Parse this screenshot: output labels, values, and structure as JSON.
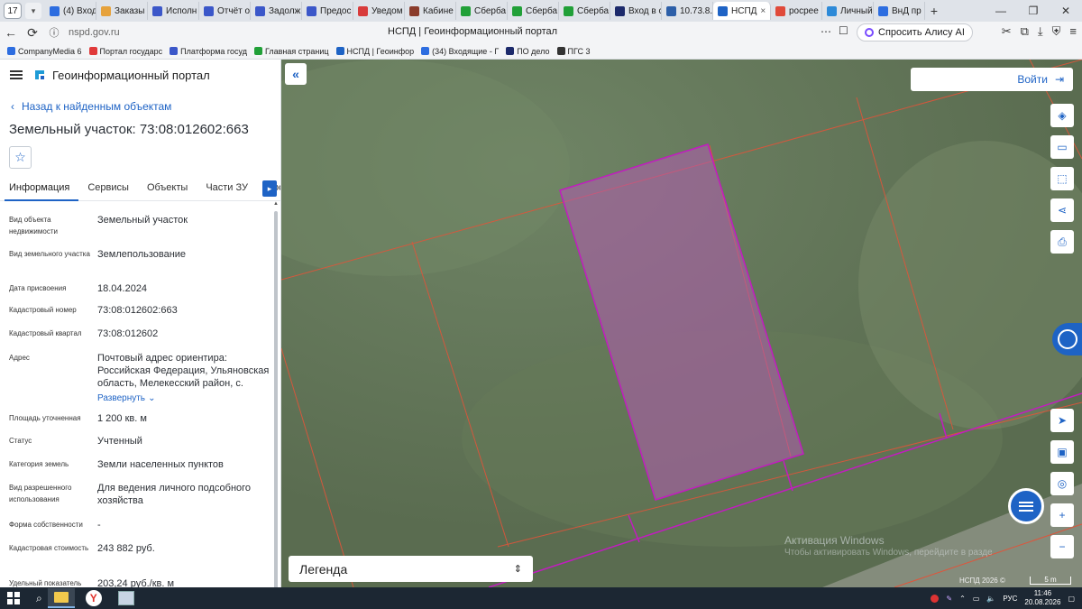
{
  "browser": {
    "tab_count": "17",
    "tabs": [
      {
        "label": "(4) Вход",
        "color": "#2d6de0"
      },
      {
        "label": "Заказы",
        "color": "#e6a23c"
      },
      {
        "label": "Исполн",
        "color": "#3b57c9"
      },
      {
        "label": "Отчёт о",
        "color": "#3b57c9"
      },
      {
        "label": "Задолж",
        "color": "#3b57c9"
      },
      {
        "label": "Предос",
        "color": "#3b57c9"
      },
      {
        "label": "Уведом",
        "color": "#d83b3b"
      },
      {
        "label": "Кабине",
        "color": "#8a3b2b"
      },
      {
        "label": "Сберба",
        "color": "#21a038"
      },
      {
        "label": "Сберба",
        "color": "#21a038"
      },
      {
        "label": "Сберба",
        "color": "#21a038"
      },
      {
        "label": "Вход в с",
        "color": "#1d2a6b"
      },
      {
        "label": "10.73.8.",
        "color": "#2d5fa8"
      },
      {
        "label": "НСПД",
        "color": "#1e63c5",
        "active": true
      },
      {
        "label": "росрее",
        "color": "#e04a3a"
      },
      {
        "label": "Личный",
        "color": "#2d8ad8"
      },
      {
        "label": "ВнД пр",
        "color": "#2d6de0"
      }
    ],
    "url": "nspd.gov.ru",
    "page_title": "НСПД | Геоинформационный портал",
    "alisa_label": "Спросить Алису AI",
    "bookmarks": [
      {
        "label": "CompanyMedia 6",
        "color": "#2d6de0"
      },
      {
        "label": "Портал государс",
        "color": "#e03a3a"
      },
      {
        "label": "Платформа госуд",
        "color": "#3b57c9"
      },
      {
        "label": "Главная страниц",
        "color": "#21a038"
      },
      {
        "label": "НСПД | Геоинфор",
        "color": "#1e63c5"
      },
      {
        "label": "(34) Входящие - Г",
        "color": "#2d6de0"
      },
      {
        "label": "ПО дело",
        "color": "#1d2a6b"
      },
      {
        "label": "ПГС 3",
        "color": "#333333"
      }
    ]
  },
  "portal": {
    "title": "Геоинформационный портал",
    "back_label": "Назад к найденным объектам",
    "object_title": "Земельный участок: 73:08:012602:663",
    "tabs": [
      "Информация",
      "Сервисы",
      "Объекты",
      "Части ЗУ",
      "Состав"
    ],
    "properties": [
      {
        "key": "Вид объекта недвижимости",
        "value": "Земельный участок"
      },
      {
        "key": "Вид земельного участка",
        "value": "Землепользование"
      },
      {
        "key": "Дата присвоения",
        "value": "18.04.2024"
      },
      {
        "key": "Кадастровый номер",
        "value": "73:08:012602:663"
      },
      {
        "key": "Кадастровый квартал",
        "value": "73:08:012602"
      },
      {
        "key": "Адрес",
        "value": "Почтовый адрес ориентира: Российская Федерация, Ульяновская область, Мелекесский район, с."
      },
      {
        "key": "Площадь уточненная",
        "value": "1 200 кв. м"
      },
      {
        "key": "Статус",
        "value": "Учтенный"
      },
      {
        "key": "Категория земель",
        "value": "Земли населенных пунктов"
      },
      {
        "key": "Вид разрешенного использования",
        "value": "Для ведения личного подсобного хозяйства"
      },
      {
        "key": "Форма собственности",
        "value": "-"
      },
      {
        "key": "Кадастровая стоимость",
        "value": "243 882 руб."
      },
      {
        "key": "Удельный показатель",
        "value": "203,24 руб./кв. м"
      }
    ],
    "expand_label": "Развернуть"
  },
  "map": {
    "login_label": "Войти",
    "legend_label": "Легенда",
    "watermark_title": "Активация Windows",
    "watermark_sub": "Чтобы активировать Windows, перейдите в раздел \"Параметры\".",
    "copyright": "НСПД 2026 ©",
    "scale": "5 m",
    "colors": {
      "parcel_fill": "#b25bb0",
      "parcel_stroke": "#c21cc0",
      "boundary": "#e0543a",
      "accent": "#1e63c5"
    }
  },
  "taskbar": {
    "lang": "РУС",
    "time": "11:46",
    "date": "20.08.2026"
  }
}
